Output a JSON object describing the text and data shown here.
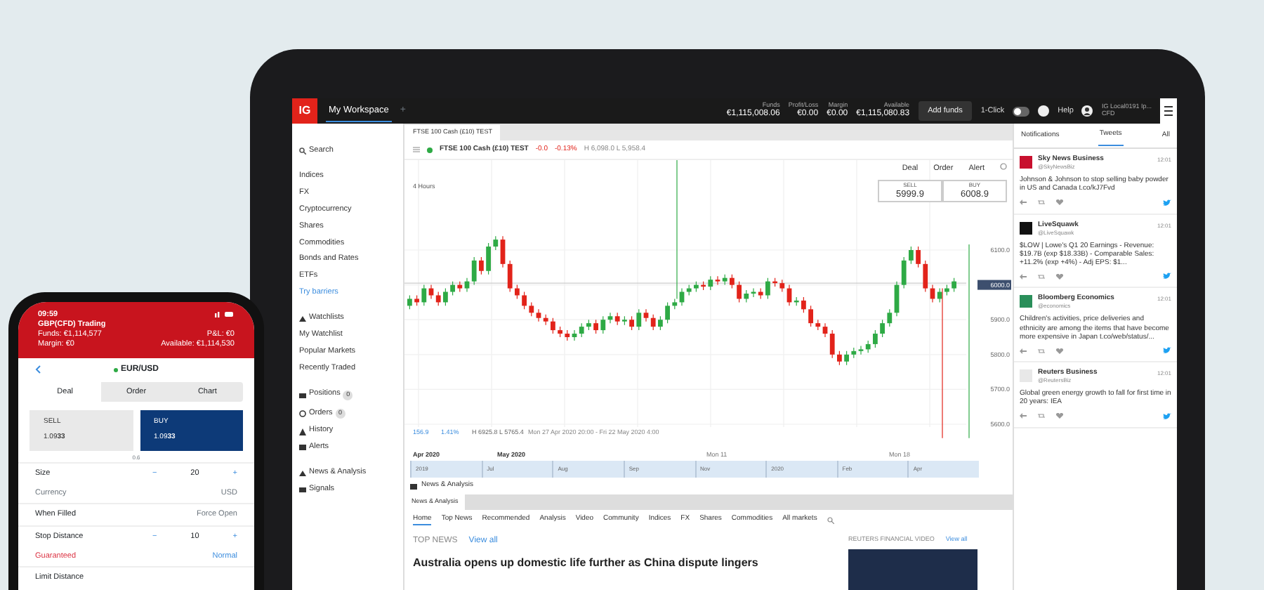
{
  "top_bar": {
    "logo": "IG",
    "workspace": "My Workspace",
    "add_tab": "+",
    "figures": [
      {
        "label": "Funds",
        "value": "€1,115,008.06"
      },
      {
        "label": "Profit/Loss",
        "value": "€0.00"
      },
      {
        "label": "Margin",
        "value": "€0.00"
      },
      {
        "label": "Available",
        "value": "€1,115,080.83"
      }
    ],
    "add_funds": "Add funds",
    "one_click": {
      "label": "1-Click",
      "on": false
    },
    "help": "Help",
    "account": {
      "name": "IG Local0191 Ip...",
      "type": "CFD"
    }
  },
  "sidebar": {
    "search": "Search",
    "groups": [
      {
        "items": [
          {
            "label": "Indices",
            "kind": "market"
          },
          {
            "label": "FX",
            "kind": "market"
          },
          {
            "label": "Cryptocurrency",
            "kind": "market"
          },
          {
            "label": "Shares",
            "kind": "market"
          },
          {
            "label": "Commodities",
            "kind": "market"
          },
          {
            "label": "Bonds and Rates",
            "kind": "market"
          },
          {
            "label": "ETFs",
            "kind": "market"
          },
          {
            "label": "Try barriers",
            "kind": "promo"
          }
        ]
      },
      {
        "items": [
          {
            "label": "Watchlists",
            "kind": "section"
          },
          {
            "label": "My Watchlist",
            "kind": "market"
          },
          {
            "label": "Popular Markets",
            "kind": "market"
          },
          {
            "label": "Recently Traded",
            "kind": "market"
          }
        ]
      },
      {
        "items": [
          {
            "label": "Positions",
            "kind": "section",
            "count": "0"
          },
          {
            "label": "Orders",
            "kind": "section",
            "count": "0"
          },
          {
            "label": "History",
            "kind": "section"
          },
          {
            "label": "Alerts",
            "kind": "section"
          }
        ]
      },
      {
        "items": [
          {
            "label": "News & Analysis",
            "kind": "section"
          },
          {
            "label": "Signals",
            "kind": "section"
          }
        ]
      }
    ]
  },
  "chart_panel": {
    "tab": "FTSE 100 Cash (£10) TEST",
    "market": "FTSE 100 Cash (£10) TEST",
    "change": "-0.0",
    "change_pct": "-0.13%",
    "high_low": "H 6,098.0 L 5,958.4",
    "actions": [
      "Deal",
      "Order",
      "Alert"
    ],
    "sell": {
      "label": "SELL",
      "price": "5999.9"
    },
    "buy": {
      "label": "BUY",
      "price": "6008.9"
    },
    "interval": "4 Hours",
    "date_labels": [
      "Apr 2020",
      "May 2020",
      "Mon 11",
      "Mon 18"
    ],
    "chart_data": {
      "type": "candlestick",
      "grid": true,
      "ylim": [
        5600,
        6100
      ],
      "ref_lines": [
        {
          "axis": "y",
          "value": 6005
        }
      ],
      "yticks": [
        {
          "value": 6100,
          "label": "6100.0"
        },
        {
          "value": 5900,
          "label": "5900.0"
        },
        {
          "value": 5800,
          "label": "5800.0"
        },
        {
          "value": 5700,
          "label": "5700.0"
        },
        {
          "value": 5600,
          "label": "5600.0"
        }
      ],
      "ohlc": [
        [
          5940,
          5970,
          5930,
          5960
        ],
        [
          5960,
          5970,
          5940,
          5950
        ],
        [
          5950,
          6000,
          5940,
          5990
        ],
        [
          5990,
          6000,
          5960,
          5970
        ],
        [
          5970,
          5980,
          5940,
          5950
        ],
        [
          5950,
          5990,
          5940,
          5980
        ],
        [
          5980,
          6010,
          5970,
          6000
        ],
        [
          6000,
          6010,
          5980,
          5990
        ],
        [
          5990,
          6020,
          5980,
          6010
        ],
        [
          6010,
          6080,
          6000,
          6070
        ],
        [
          6070,
          6080,
          6030,
          6040
        ],
        [
          6040,
          6120,
          6030,
          6110
        ],
        [
          6110,
          6140,
          6100,
          6130
        ],
        [
          6130,
          6140,
          6050,
          6060
        ],
        [
          6060,
          6070,
          5980,
          5990
        ],
        [
          5990,
          6000,
          5960,
          5970
        ],
        [
          5970,
          5980,
          5930,
          5940
        ],
        [
          5940,
          5950,
          5910,
          5920
        ],
        [
          5920,
          5930,
          5895,
          5905
        ],
        [
          5905,
          5915,
          5885,
          5895
        ],
        [
          5895,
          5905,
          5860,
          5870
        ],
        [
          5870,
          5880,
          5850,
          5860
        ],
        [
          5860,
          5870,
          5840,
          5850
        ],
        [
          5850,
          5870,
          5840,
          5860
        ],
        [
          5860,
          5890,
          5850,
          5880
        ],
        [
          5880,
          5900,
          5870,
          5890
        ],
        [
          5890,
          5900,
          5860,
          5870
        ],
        [
          5870,
          5910,
          5860,
          5900
        ],
        [
          5900,
          5920,
          5890,
          5910
        ],
        [
          5910,
          5920,
          5885,
          5895
        ],
        [
          5895,
          5910,
          5885,
          5900
        ],
        [
          5900,
          5910,
          5870,
          5880
        ],
        [
          5880,
          5930,
          5870,
          5920
        ],
        [
          5920,
          5930,
          5895,
          5905
        ],
        [
          5905,
          5915,
          5870,
          5880
        ],
        [
          5880,
          5910,
          5870,
          5900
        ],
        [
          5900,
          5950,
          5890,
          5940
        ],
        [
          5940,
          5960,
          5930,
          5950
        ],
        [
          5950,
          5990,
          5940,
          5980
        ],
        [
          5980,
          6000,
          5970,
          5990
        ],
        [
          5990,
          6010,
          5980,
          6000
        ],
        [
          6000,
          6010,
          5985,
          5995
        ],
        [
          5995,
          6025,
          5985,
          6015
        ],
        [
          6015,
          6025,
          6000,
          6010
        ],
        [
          6010,
          6030,
          6000,
          6020
        ],
        [
          6020,
          6030,
          5990,
          6000
        ],
        [
          6000,
          6010,
          5950,
          5960
        ],
        [
          5960,
          5985,
          5950,
          5975
        ],
        [
          5975,
          5990,
          5965,
          5980
        ],
        [
          5980,
          5990,
          5960,
          5970
        ],
        [
          5970,
          6020,
          5960,
          6010
        ],
        [
          6010,
          6020,
          5995,
          6005
        ],
        [
          6005,
          6015,
          5980,
          5990
        ],
        [
          5990,
          6000,
          5940,
          5950
        ],
        [
          5950,
          5965,
          5940,
          5955
        ],
        [
          5955,
          5965,
          5920,
          5930
        ],
        [
          5930,
          5940,
          5880,
          5890
        ],
        [
          5890,
          5900,
          5870,
          5880
        ],
        [
          5880,
          5890,
          5850,
          5860
        ],
        [
          5860,
          5870,
          5790,
          5800
        ],
        [
          5800,
          5810,
          5770,
          5780
        ],
        [
          5780,
          5810,
          5770,
          5800
        ],
        [
          5800,
          5820,
          5790,
          5810
        ],
        [
          5810,
          5825,
          5800,
          5815
        ],
        [
          5815,
          5840,
          5805,
          5830
        ],
        [
          5830,
          5870,
          5820,
          5860
        ],
        [
          5860,
          5900,
          5850,
          5890
        ],
        [
          5890,
          5930,
          5880,
          5920
        ],
        [
          5920,
          6010,
          5910,
          6000
        ],
        [
          6000,
          6080,
          5990,
          6070
        ],
        [
          6070,
          6110,
          6060,
          6100
        ],
        [
          6100,
          6110,
          6050,
          6060
        ],
        [
          6060,
          6070,
          5980,
          5990
        ],
        [
          5990,
          6000,
          5950,
          5960
        ],
        [
          5960,
          5990,
          5950,
          5980
        ],
        [
          5980,
          6000,
          5970,
          5990
        ],
        [
          5990,
          6020,
          5980,
          6010
        ]
      ]
    },
    "current_price": "6000.0",
    "stats": {
      "change": "156.9",
      "change_pct": "1.41%",
      "high_low": "H 6925.8 L 5765.4",
      "range": "Mon 27 Apr 2020 20:00 - Fri 22 May 2020 4:00"
    },
    "navigator_labels": [
      "2019",
      "Jul",
      "Aug",
      "Sep",
      "Nov",
      "2020",
      "Feb",
      "Apr"
    ]
  },
  "news": {
    "header": "News & Analysis",
    "tab": "News & Analysis",
    "nav": [
      {
        "label": "Home",
        "selected": true
      },
      {
        "label": "Top News",
        "selected": false
      },
      {
        "label": "Recommended",
        "selected": false
      },
      {
        "label": "Analysis",
        "selected": false
      },
      {
        "label": "Video",
        "selected": false
      },
      {
        "label": "Community",
        "selected": false
      },
      {
        "label": "Indices",
        "selected": false
      },
      {
        "label": "FX",
        "selected": false
      },
      {
        "label": "Shares",
        "selected": false
      },
      {
        "label": "Commodities",
        "selected": false
      },
      {
        "label": "All markets",
        "selected": false
      }
    ],
    "top_news": "TOP NEWS",
    "top_view_all": "View all",
    "headline": "Australia opens up domestic life further as China dispute lingers",
    "video_title": "REUTERS FINANCIAL VIDEO",
    "video_view_all": "View all"
  },
  "social": {
    "tabs": [
      {
        "label": "Notifications",
        "selected": false
      },
      {
        "label": "Tweets",
        "selected": true
      },
      {
        "label": "All",
        "selected": false
      }
    ],
    "tweets": [
      {
        "name": "Sky News Business",
        "handle": "@SkyNewsBiz",
        "time": "12:01",
        "text": "Johnson & Johnson to stop selling baby powder in US and Canada t.co/kJ7Fvd",
        "color": "#c8102e"
      },
      {
        "name": "LiveSquawk",
        "handle": "@LiveSquawk",
        "time": "12:01",
        "text": "$LOW | Lowe's Q1 20 Earnings - Revenue: $19.7B (exp $18.33B) - Comparable Sales: +11.2% (exp +4%) - Adj EPS: $1...",
        "color": "#111111"
      },
      {
        "name": "Bloomberg Economics",
        "handle": "@economics",
        "time": "12:01",
        "text": "Children's activities, price deliveries and ethnicity are among the items that have become more expensive in Japan t.co/web/status/...",
        "color": "#2a8f5a"
      },
      {
        "name": "Reuters Business",
        "handle": "@ReutersBiz",
        "time": "12:01",
        "text": "Global green energy growth to fall for first time in 20 years: IEA",
        "color": "#e8e8e8"
      }
    ]
  },
  "phone": {
    "time": "09:59",
    "account": "GBP(CFD) Trading",
    "funds": "Funds: €1,114,577",
    "margin": "Margin: €0",
    "pl": "P&L: €0",
    "available": "Available: €1,114,530",
    "market": "EUR/USD",
    "tabs": [
      {
        "label": "Deal",
        "selected": true
      },
      {
        "label": "Order",
        "selected": false
      },
      {
        "label": "Chart",
        "selected": false
      }
    ],
    "sell": {
      "label": "SELL",
      "price": "1.09**33**"
    },
    "buy": {
      "label": "BUY",
      "price": "1.09**33**"
    },
    "spread": "0.6",
    "rows": [
      {
        "label": "Size",
        "value": "20",
        "kind": "stepper",
        "minus": "−",
        "plus": "+"
      },
      {
        "label": "Currency",
        "value": "USD",
        "kind": "note"
      },
      {
        "label": "When Filled",
        "value": "Force Open",
        "kind": "value"
      },
      {
        "label": "Stop Distance",
        "value": "10",
        "kind": "stepper",
        "minus": "−",
        "plus": "+"
      },
      {
        "label": "Guaranteed",
        "value": "Normal",
        "kind": "warning"
      },
      {
        "label": "Limit Distance",
        "kind": "value"
      }
    ]
  }
}
